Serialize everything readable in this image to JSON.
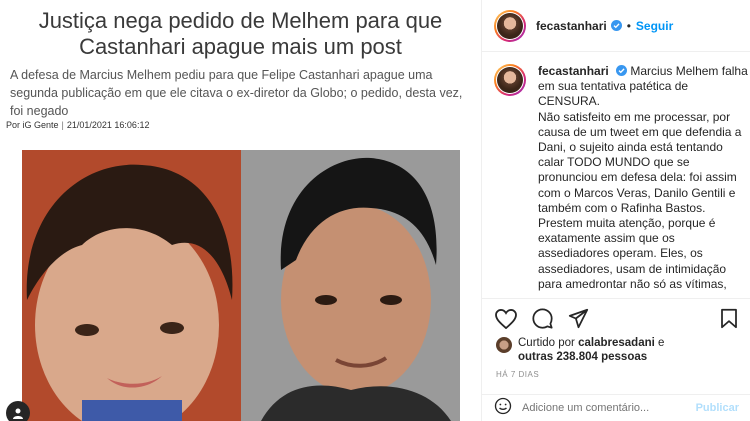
{
  "article": {
    "headline_line1": "Justiça nega pedido de Melhem para que",
    "headline_line2": "Castanhari apague mais um post",
    "subtitle": "A defesa de Marcius Melhem pediu para que Felipe Castanhari apague uma segunda publicação em que ele citava o ex-diretor da Globo; o pedido, desta vez, foi negado",
    "byline_source": "Por iG Gente",
    "byline_date": "21/01/2021 16:06:12"
  },
  "post": {
    "username": "fecastanhari",
    "separator": "•",
    "follow_label": "Seguir",
    "caption_username": "fecastanhari",
    "caption_paragraphs": [
      "Marcius Melhem falha em sua tentativa patética de CENSURA.",
      "Não satisfeito em me processar, por causa de um tweet em que defendia a Dani, o sujeito ainda está tentando calar TODO MUNDO que se pronunciou em defesa dela: foi assim com o Marcos Veras, Danilo Gentili e também com o Rafinha Bastos.",
      "Prestem muita atenção, porque é exatamente assim que os assediadores operam. Eles, os assediadores, usam de intimidação para amedrontar não só as vítimas,"
    ],
    "likes_prefix": "Curtido por",
    "likes_user": "calabresadani",
    "likes_and": "e",
    "likes_others": "outras 238.804 pessoas",
    "time_ago": "HÁ 7 DIAS",
    "comment_placeholder": "Adicione um comentário...",
    "publish_label": "Publicar"
  },
  "icons": {
    "like": "heart-icon",
    "comment": "comment-icon",
    "share": "paper-plane-icon",
    "save": "bookmark-icon",
    "emoji": "smiley-icon",
    "verified": "verified-badge-icon"
  },
  "colors": {
    "accent": "#0095f6",
    "verified": "#3897f0",
    "publish_disabled": "#b2dffc"
  }
}
